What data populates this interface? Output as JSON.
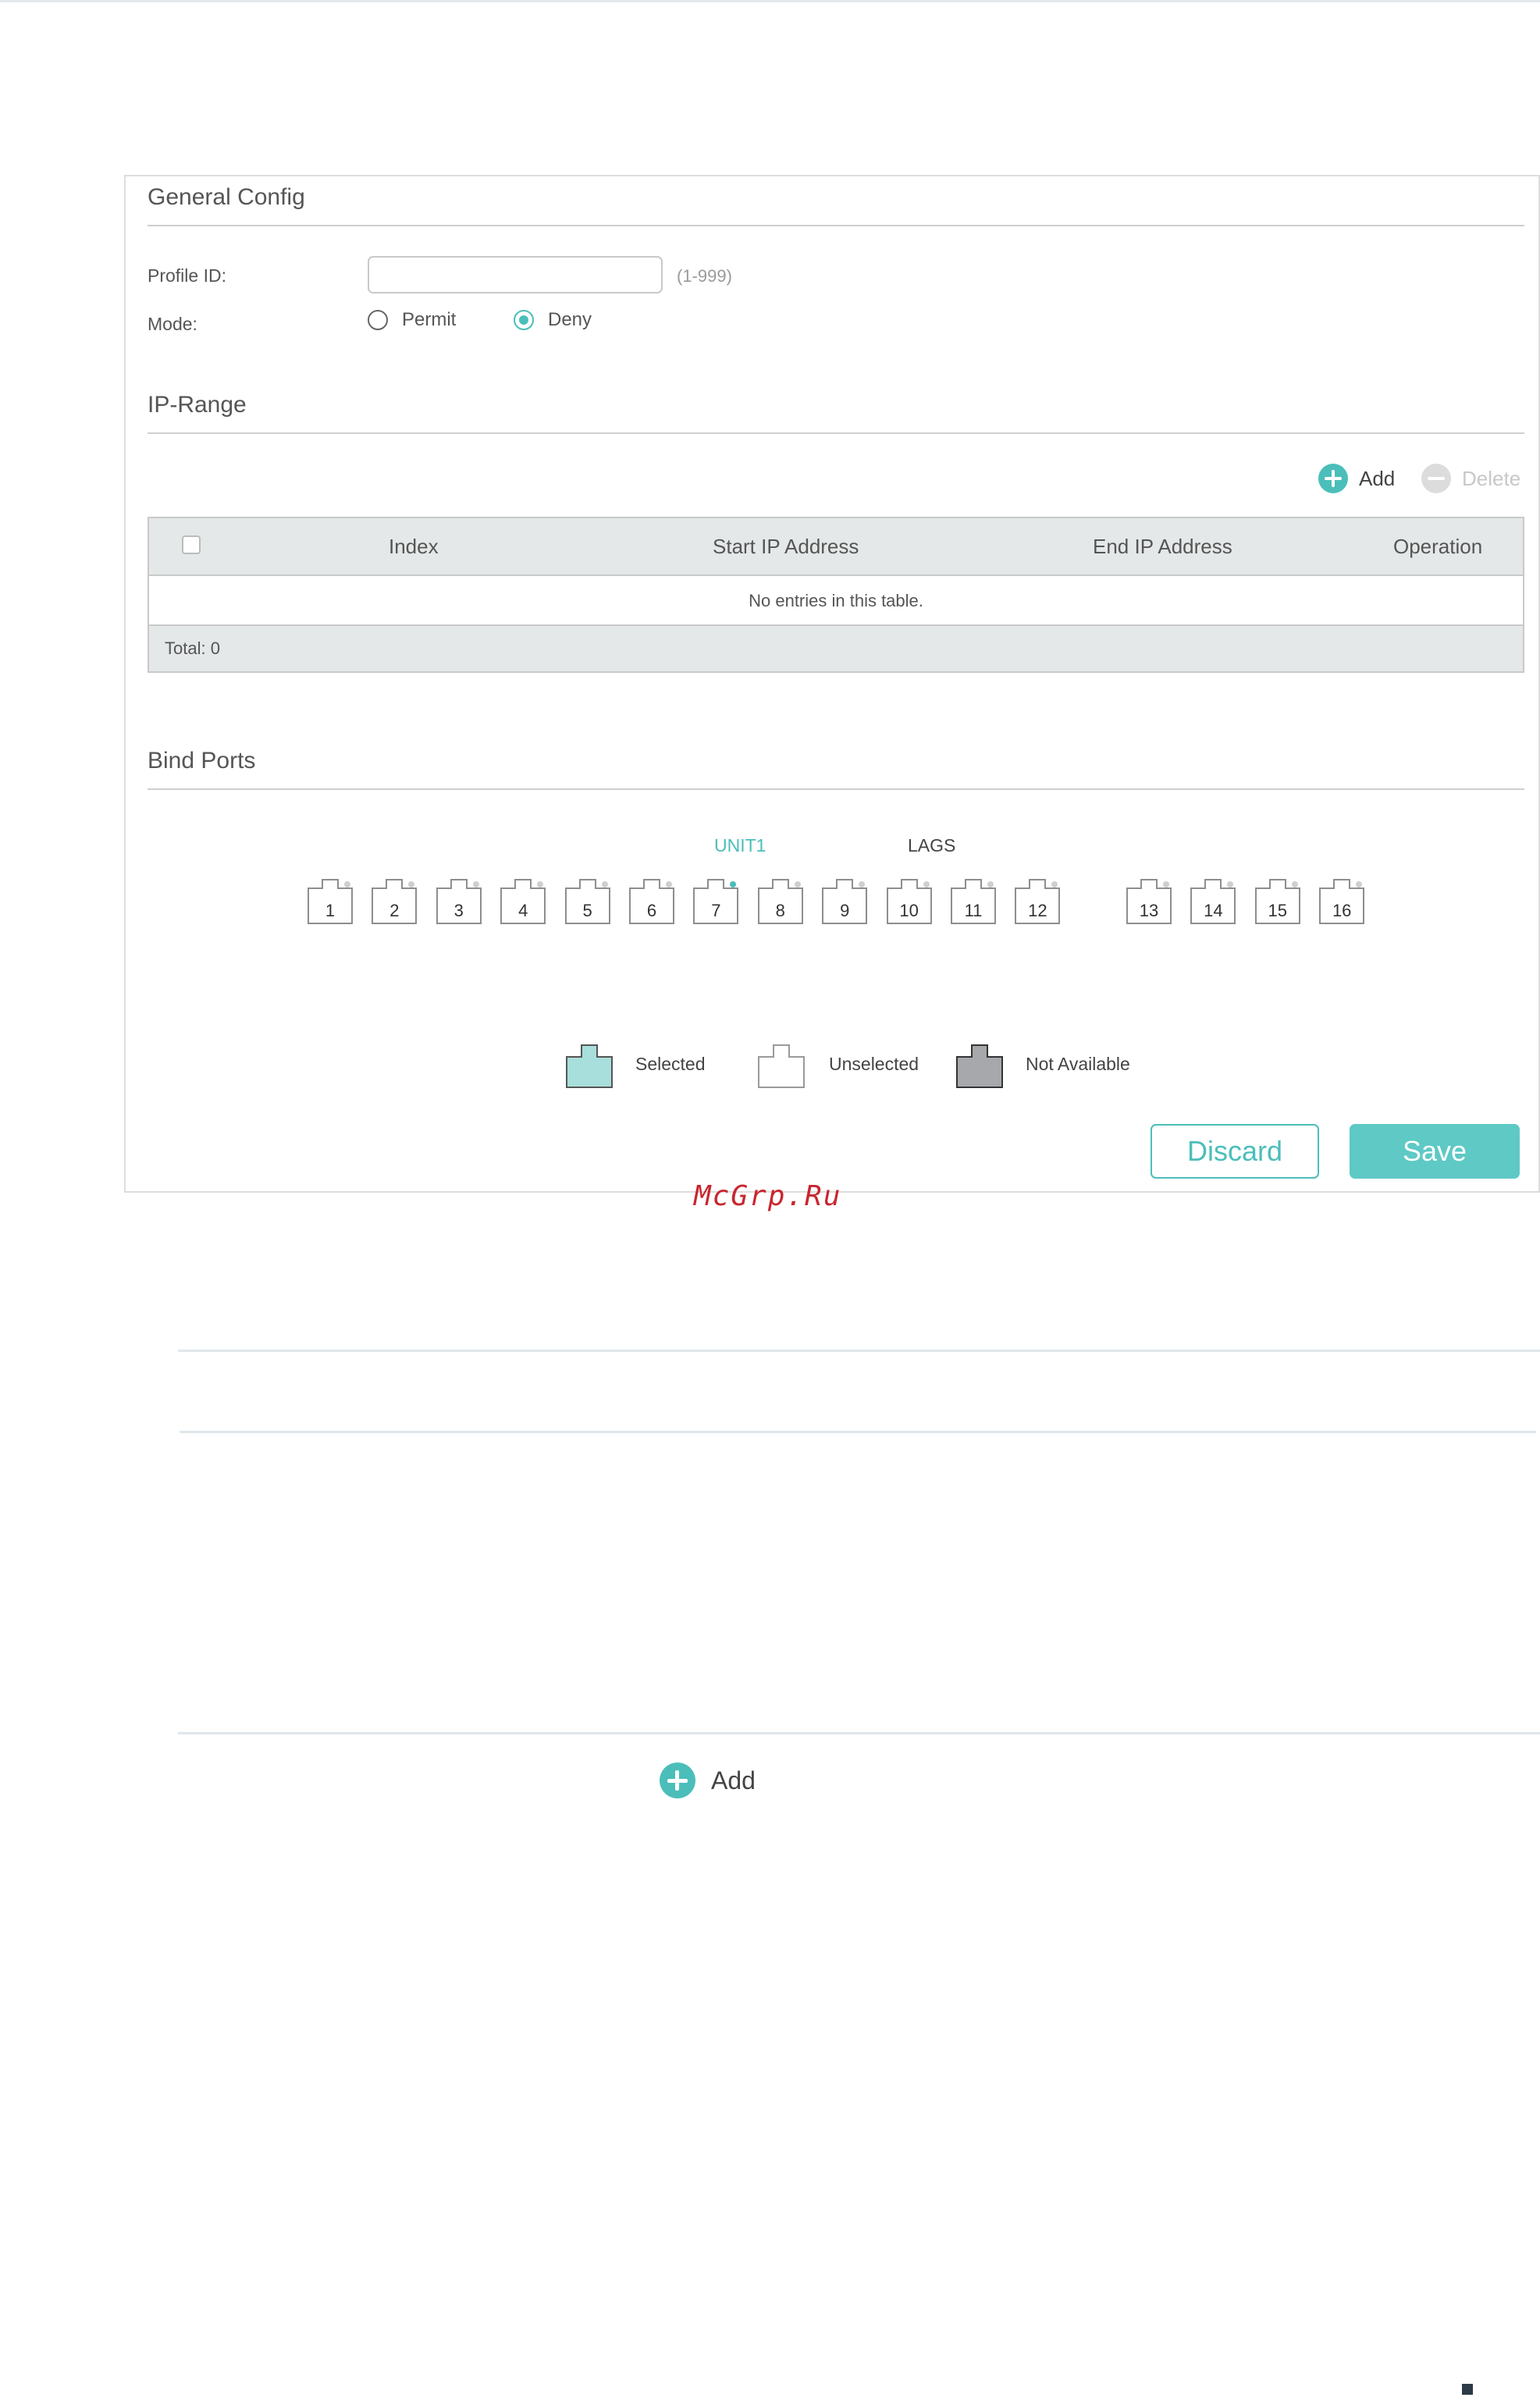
{
  "general_config": {
    "title": "General Config",
    "profile_id_label": "Profile ID:",
    "profile_id_value": "",
    "profile_id_hint": "(1-999)",
    "mode_label": "Mode:",
    "mode_options": [
      "Permit",
      "Deny"
    ],
    "mode_selected": "Deny"
  },
  "ip_range": {
    "title": "IP-Range",
    "add_label": "Add",
    "delete_label": "Delete",
    "columns": [
      "Index",
      "Start IP Address",
      "End IP Address",
      "Operation"
    ],
    "empty_text": "No entries in this table.",
    "total_text": "Total: 0"
  },
  "bind_ports": {
    "title": "Bind Ports",
    "tabs": [
      "UNIT1",
      "LAGS"
    ],
    "active_tab": "UNIT1",
    "ports": [
      "1",
      "2",
      "3",
      "4",
      "5",
      "6",
      "7",
      "8",
      "9",
      "10",
      "11",
      "12",
      "13",
      "14",
      "15",
      "16"
    ],
    "legend": [
      "Selected",
      "Unselected",
      "Not Available"
    ]
  },
  "buttons": {
    "discard": "Discard",
    "save": "Save"
  },
  "watermark": "McGrp.Ru",
  "lower": {
    "add_label": "Add"
  },
  "colors": {
    "accent": "#4bbeba",
    "selected_fill": "#a8dedb",
    "not_available_fill": "#a6a8ab"
  }
}
